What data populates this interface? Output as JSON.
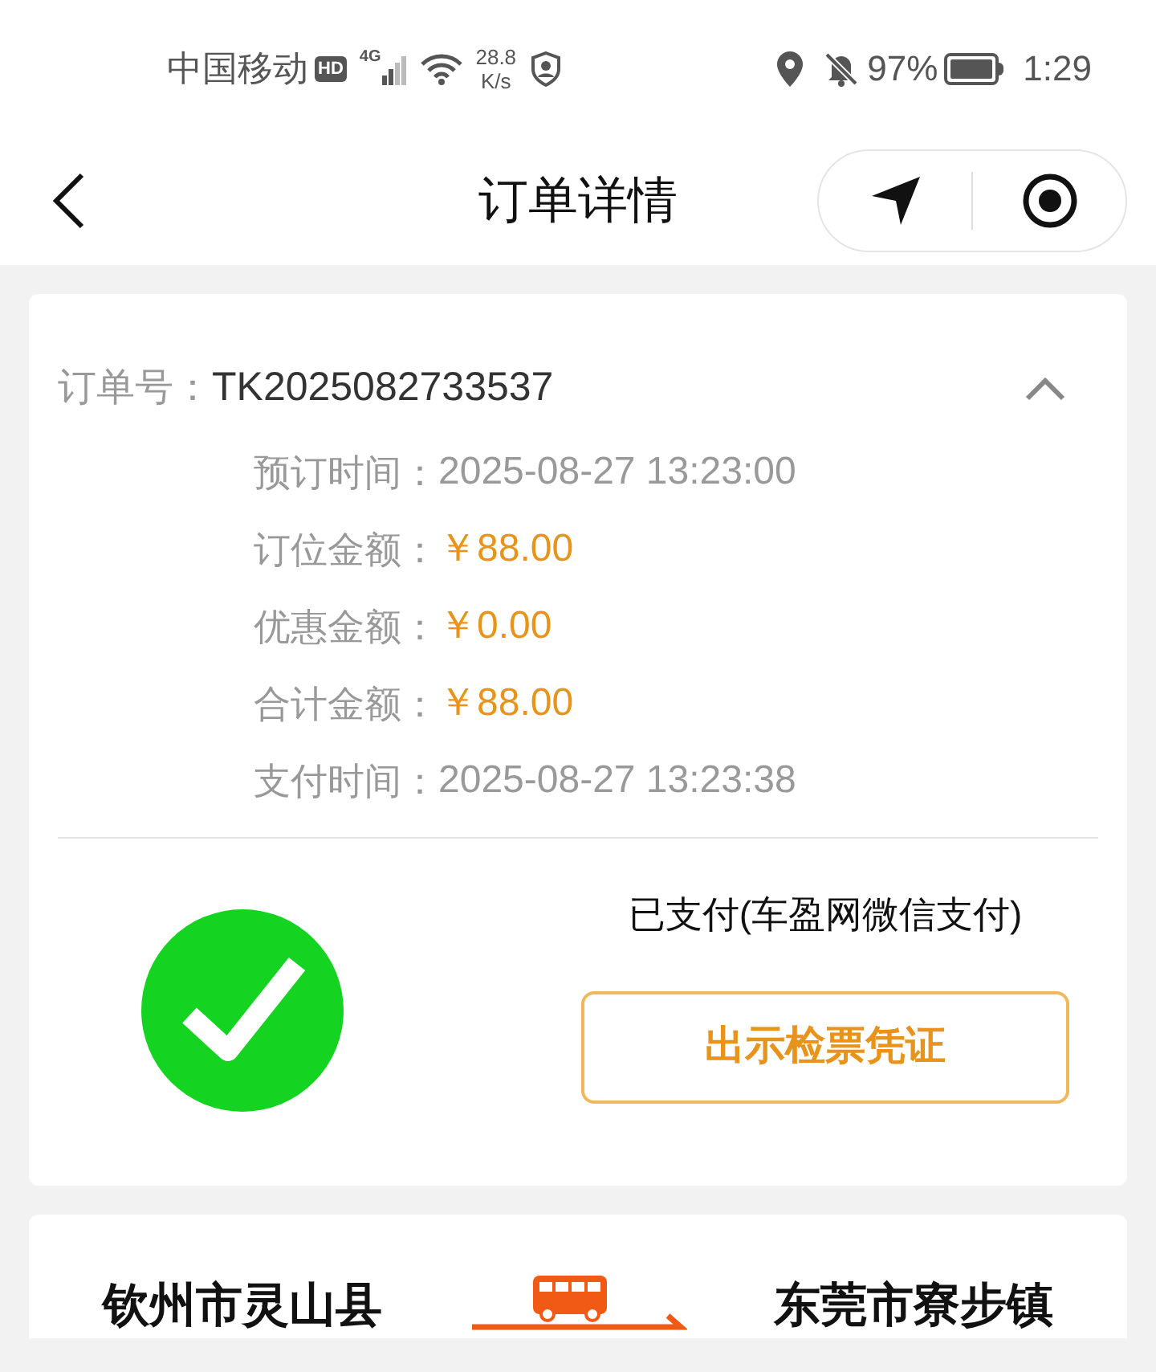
{
  "status_bar": {
    "carrier": "中国移动",
    "hd": "HD",
    "network": "4G",
    "speed_value": "28.8",
    "speed_unit": "K/s",
    "battery": "97%",
    "time": "1:29"
  },
  "header": {
    "title": "订单详情"
  },
  "order": {
    "label": "订单号：",
    "number": "TK2025082733537",
    "expanded": true,
    "details": [
      {
        "label": "预订时间：",
        "value": "2025-08-27 13:23:00",
        "kind": "time"
      },
      {
        "label": "订位金额：",
        "value": "￥88.00",
        "kind": "amount"
      },
      {
        "label": "优惠金额：",
        "value": "￥0.00",
        "kind": "amount"
      },
      {
        "label": "合计金额：",
        "value": "￥88.00",
        "kind": "amount"
      },
      {
        "label": "支付时间：",
        "value": "2025-08-27 13:23:38",
        "kind": "time"
      }
    ],
    "payment_status": "已支付(车盈网微信支付)",
    "ticket_button": "出示检票凭证"
  },
  "route": {
    "from": "钦州市灵山县",
    "to": "东莞市寮步镇"
  }
}
